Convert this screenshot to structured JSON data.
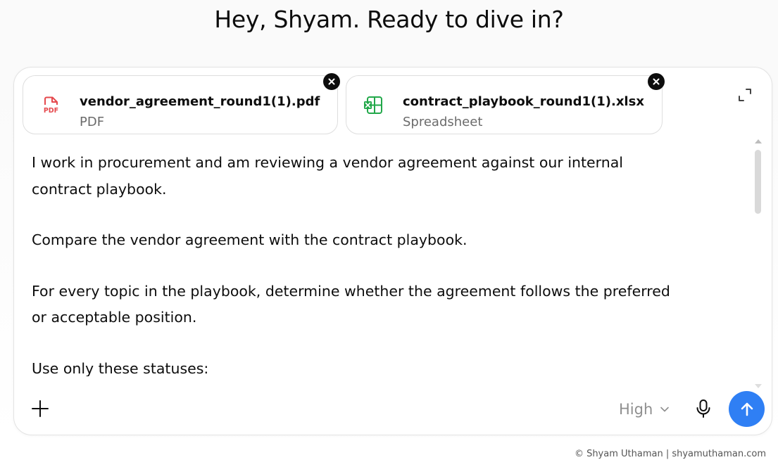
{
  "greeting": "Hey, Shyam. Ready to dive in?",
  "attachments": [
    {
      "name": "vendor_agreement_round1(1).pdf",
      "type": "PDF",
      "icon": "pdf-file-icon",
      "icon_label": "PDF",
      "accent": "#e5484d"
    },
    {
      "name": "contract_playbook_round1(1).xlsx",
      "type": "Spreadsheet",
      "icon": "spreadsheet-icon",
      "accent": "#22a84a"
    }
  ],
  "prompt": {
    "paragraphs": [
      "I work in procurement and am reviewing a vendor agreement against our internal contract playbook.",
      "Compare the vendor agreement with the contract playbook.",
      "For every topic in the playbook, determine whether the agreement follows the preferred or acceptable position.",
      "Use only these statuses:"
    ]
  },
  "toolbar": {
    "effort_label": "High",
    "plus_icon": "plus-icon",
    "mic_icon": "microphone-icon",
    "send_icon": "arrow-up-icon",
    "send_color": "#2f7ff4"
  },
  "footer": "© Shyam Uthaman | shyamuthaman.com"
}
